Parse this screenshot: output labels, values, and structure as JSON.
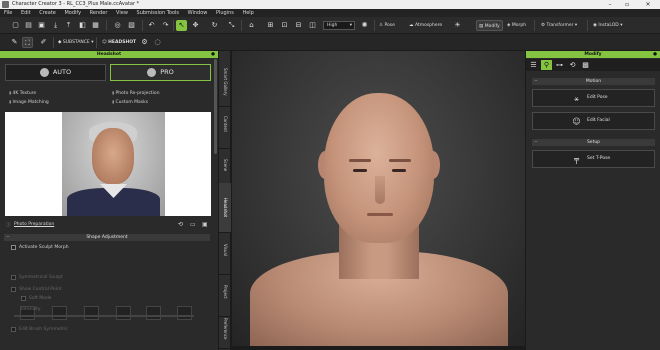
{
  "window": {
    "title": "Character Creator 3 - RL_CC3_Plus Male.ccAvatar *"
  },
  "menu": [
    "File",
    "Edit",
    "Create",
    "Modify",
    "Render",
    "View",
    "Submission Tools",
    "Window",
    "Plugins",
    "Help"
  ],
  "toolbar": {
    "quality_select": "High",
    "pose_label": "Pose",
    "atmosphere_label": "Atmosphere",
    "modify_label": "Modify",
    "morph_label": "Morph",
    "transformer_label": "Transformer",
    "instalod_label": "InstaLOD",
    "substance_label": "SUBSTANCE",
    "headshot_label": "HEADSHOT"
  },
  "headshot_panel": {
    "title": "Headshot",
    "auto_label": "AUTO",
    "pro_label": "PRO",
    "features": [
      "4K Texture",
      "Photo Re-projection",
      "Image Matching",
      "Custom Masks"
    ],
    "photo_prep_label": "Photo Preparation",
    "shape_adjustment_label": "Shape Adjustment",
    "activate_sculpt_label": "Activate Sculpt Morph",
    "symmetrical_label": "Symmetrical Sculpt",
    "show_control_label": "Show Control Point",
    "soft_mode_label": "Soft Mode",
    "intensity_label": "Intensity",
    "edit_brush_label": "Edit Brush Symmetric"
  },
  "side_tabs": [
    "Smart Gallery",
    "Content",
    "Scene",
    "Headshot",
    "Visual",
    "Project",
    "Preference"
  ],
  "modify_panel": {
    "title": "Modify",
    "motion_label": "Motion",
    "edit_pose_label": "Edit Pose",
    "edit_facial_label": "Edit Facial",
    "setup_label": "Setup",
    "set_tpose_label": "Set T-Pose"
  },
  "colors": {
    "accent": "#85c441",
    "panel_bg": "#2a2a2a",
    "viewport_bg": "#3a3a3a"
  }
}
